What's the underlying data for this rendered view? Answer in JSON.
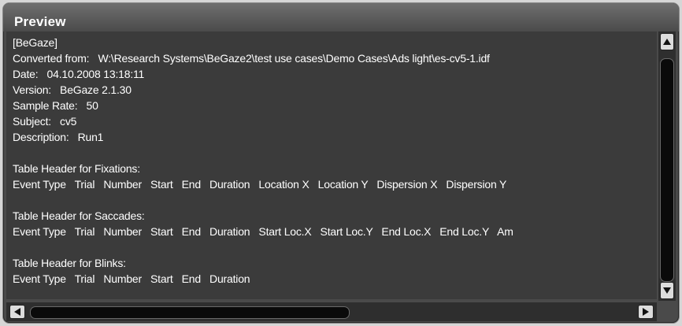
{
  "panel": {
    "title": "Preview"
  },
  "preview_lines": [
    "[BeGaze]",
    "Converted from:   W:\\Research Systems\\BeGaze2\\test use cases\\Demo Cases\\Ads light\\es-cv5-1.idf",
    "Date:   04.10.2008 13:18:11",
    "Version:   BeGaze 2.1.30",
    "Sample Rate:   50",
    "Subject:   cv5",
    "Description:   Run1",
    "",
    "Table Header for Fixations:",
    "Event Type   Trial   Number   Start   End   Duration   Location X   Location Y   Dispersion X   Dispersion Y",
    "",
    "Table Header for Saccades:",
    "Event Type   Trial   Number   Start   End   Duration   Start Loc.X   Start Loc.Y   End Loc.X   End Loc.Y   Am",
    "",
    "Table Header for Blinks:",
    "Event Type   Trial   Number   Start   End   Duration"
  ],
  "scrollbars": {
    "vertical": {
      "up_icon": "arrow-up-icon",
      "down_icon": "arrow-down-icon"
    },
    "horizontal": {
      "left_icon": "arrow-left-icon",
      "right_icon": "arrow-right-icon"
    }
  },
  "colors": {
    "background": "#3b3b3b",
    "text": "#ffffff",
    "title_bar": "#5a5a5a"
  }
}
